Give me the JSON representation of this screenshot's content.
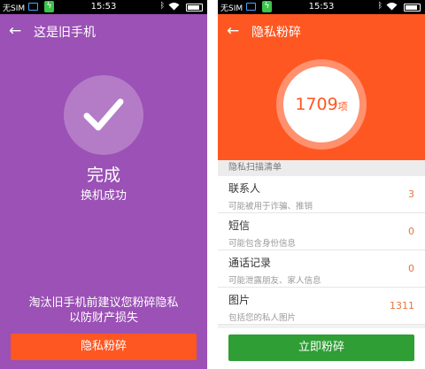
{
  "status_bar": {
    "carrier": "无SIM",
    "time": "15:53",
    "charge_icon": "lightning-icon",
    "bluetooth_icon": "bluetooth-icon",
    "wifi_icon": "wifi-icon",
    "battery_icon": "battery-icon"
  },
  "left_screen": {
    "back_icon": "arrow-left-icon",
    "title": "这是旧手机",
    "check_icon": "checkmark-icon",
    "done_title": "完成",
    "done_subtitle": "换机成功",
    "hint_line1": "淘汰旧手机前建议您粉碎隐私",
    "hint_line2": "以防财产损失",
    "button_label": "隐私粉碎",
    "background_color": "#9B51B5",
    "button_color": "#FF5722"
  },
  "right_screen": {
    "back_icon": "arrow-left-icon",
    "title": "隐私粉碎",
    "score_value": "1709",
    "score_unit": "项",
    "section_header": "隐私扫描清单",
    "items": [
      {
        "name": "联系人",
        "desc": "可能被用于诈骗、推销",
        "count": "3"
      },
      {
        "name": "短信",
        "desc": "可能包含身份信息",
        "count": "0"
      },
      {
        "name": "通话记录",
        "desc": "可能泄露朋友、家人信息",
        "count": "0"
      },
      {
        "name": "图片",
        "desc": "包括您的私人图片",
        "count": "1311"
      }
    ],
    "button_label": "立即粉碎",
    "header_color": "#FF5722",
    "button_color": "#2F9E35"
  }
}
